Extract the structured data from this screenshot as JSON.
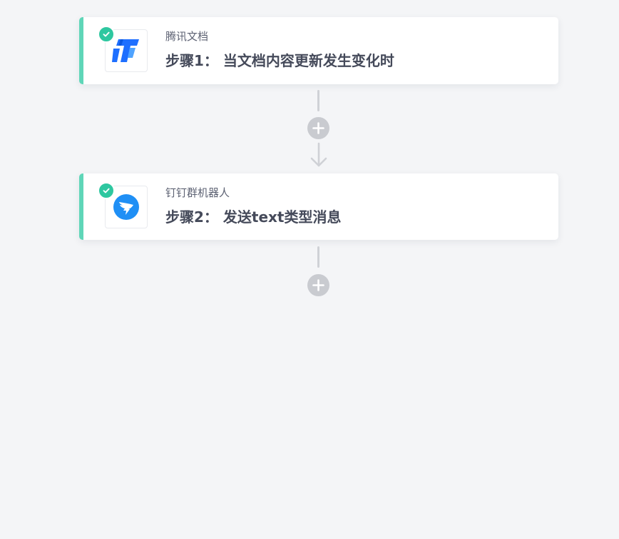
{
  "flow": {
    "steps": [
      {
        "app_name": "腾讯文档",
        "title": "步骤1： 当文档内容更新发生变化时",
        "app_icon": "tencent-docs-icon",
        "status_icon": "check-icon"
      },
      {
        "app_name": "钉钉群机器人",
        "title": "步骤2： 发送text类型消息",
        "app_icon": "dingtalk-robot-icon",
        "status_icon": "check-icon"
      }
    ],
    "add_step_icon": "plus-icon",
    "connector_icon": "arrow-down-icon"
  },
  "colors": {
    "background": "#f4f5f7",
    "card_accent": "#5fd6b8",
    "check_badge": "#2ec7a0",
    "connector": "#cfd1d6",
    "add_button": "#c9cbd0",
    "title_text": "#454a5a",
    "app_name_text": "#5d6273",
    "tencent_blue": "#1e6fff",
    "dingtalk_blue": "#1f8ff5"
  }
}
